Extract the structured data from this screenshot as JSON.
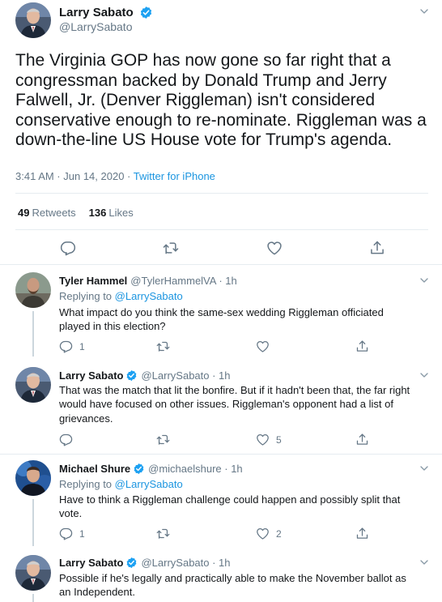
{
  "main": {
    "name": "Larry Sabato",
    "handle": "@LarrySabato",
    "text": "The Virginia GOP has now gone so far right that a congressman backed by Donald Trump and Jerry Falwell, Jr. (Denver Riggleman) isn't considered conservative enough to re-nominate. Riggleman was a down-the-line US House vote for Trump's agenda.",
    "time": "3:41 AM · Jun 14, 2020 · ",
    "source": "Twitter for iPhone",
    "retweets_count": "49",
    "retweets_label": "Retweets",
    "likes_count": "136",
    "likes_label": "Likes"
  },
  "replies": [
    {
      "name": "Tyler Hammel",
      "handle": "@TylerHammelVA · 1h",
      "replying_prefix": "Replying to ",
      "replying_to": "@LarrySabato",
      "text": "What impact do you think the same-sex wedding Riggleman officiated played in this election?",
      "reply_count": "1",
      "like_count": ""
    },
    {
      "name": "Larry Sabato",
      "handle": "@LarrySabato · 1h",
      "text": "That was the match that lit the bonfire. But if it hadn't been that, the far right would have focused on other issues. Riggleman's opponent had a list of grievances.",
      "reply_count": "",
      "like_count": "5"
    },
    {
      "name": "Michael Shure",
      "handle": "@michaelshure · 1h",
      "replying_prefix": "Replying to ",
      "replying_to": "@LarrySabato",
      "text": "Have to think a Riggleman challenge could happen and possibly split that vote.",
      "reply_count": "1",
      "like_count": "2"
    },
    {
      "name": "Larry Sabato",
      "handle": "@LarrySabato · 1h",
      "text": "Possible if he's legally and practically able to make the November ballot as an Independent."
    }
  ],
  "colors": {
    "accent": "#1b95e0",
    "verified": "#1da1f2",
    "muted": "#657786",
    "border": "#e6ecf0"
  },
  "icons": [
    "reply-icon",
    "retweet-icon",
    "like-icon",
    "share-icon",
    "chevron-down-icon",
    "verified-badge-icon"
  ]
}
